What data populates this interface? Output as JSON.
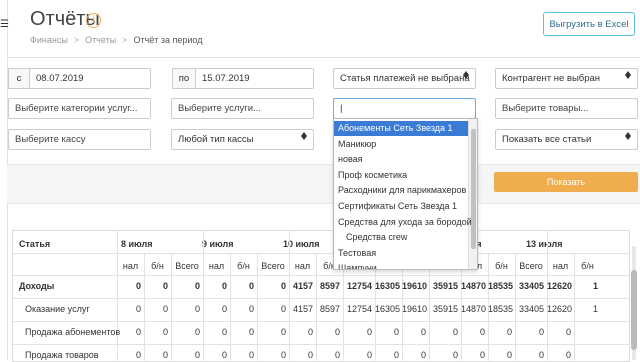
{
  "header": {
    "title": "Отчёты",
    "breadcrumbs": [
      "Финансы",
      "Отчеты",
      "Отчёт за период"
    ],
    "excel_button": "Выгрузить в Excel"
  },
  "filters": {
    "date_from_label": "с",
    "date_from": "08.07.2019",
    "date_to_label": "по",
    "date_to": "15.07.2019",
    "payment_article": "Статья платежей не выбрана",
    "counterparty": "Контрагент не выбран",
    "service_categories": "Выберите категории услуг...",
    "services": "Выберите услуги...",
    "search_value": "|",
    "products": "Выберите товары...",
    "cashbox": "Выберите кассу",
    "cashbox_type": "Любой тип кассы",
    "show_articles": "Показать все статьи",
    "show_button": "Показать"
  },
  "dropdown": {
    "items": [
      "Абонементы Сеть Звезда 1",
      "Маникюр",
      "новая",
      "Проф косметика",
      "Расходники для парикмахеров",
      "Сертификаты Сеть Звезда 1",
      "Средства для ухода за бородой",
      "Средства crew",
      "Тестовая",
      "Шампуни"
    ],
    "selected_index": 0
  },
  "table": {
    "article_header": "Статья",
    "days": [
      "8 июля",
      "9 июля",
      "10 июля",
      "12 июля",
      "13 июля"
    ],
    "sub_headers": [
      "нал",
      "б/н",
      "Всего"
    ],
    "rows": [
      {
        "name": "Доходы",
        "values": [
          "0",
          "0",
          "0",
          "0",
          "0",
          "0",
          "4157",
          "8597",
          "12754",
          "16305",
          "19610",
          "35915",
          "14870",
          "18535",
          "33405",
          "12620",
          "1"
        ],
        "bold": true
      },
      {
        "name": "Оказание услуг",
        "values": [
          "0",
          "0",
          "0",
          "0",
          "0",
          "0",
          "4157",
          "8597",
          "12754",
          "16305",
          "19610",
          "35915",
          "14870",
          "18535",
          "33405",
          "12620",
          "1"
        ],
        "bold": false
      },
      {
        "name": "Продажа абонементов",
        "values": [
          "0",
          "0",
          "0",
          "0",
          "0",
          "0",
          "0",
          "0",
          "0",
          "0",
          "0",
          "0",
          "0",
          "0",
          "0",
          "0",
          ""
        ],
        "bold": false
      },
      {
        "name": "Продажа товаров",
        "values": [
          "0",
          "0",
          "0",
          "0",
          "0",
          "0",
          "0",
          "0",
          "0",
          "0",
          "0",
          "0",
          "0",
          "0",
          "0",
          "0",
          ""
        ],
        "bold": false
      }
    ]
  }
}
